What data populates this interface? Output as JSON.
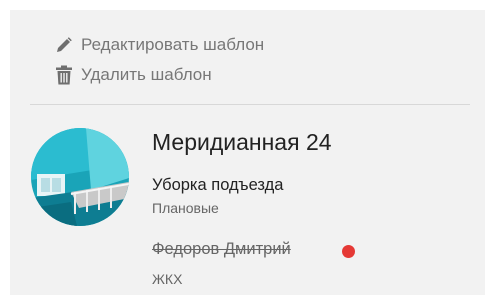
{
  "actions": {
    "edit": {
      "label": "Редактировать шаблон",
      "icon": "pencil-icon"
    },
    "delete": {
      "label": "Удалить шаблон",
      "icon": "trash-icon"
    }
  },
  "card": {
    "title": "Меридианная 24",
    "task": "Уборка подъезда",
    "type": "Плановые",
    "person": "Федоров Дмитрий",
    "person_status_color": "#e53935",
    "org": "ЖКХ",
    "avatar": "stairwell-photo"
  },
  "colors": {
    "panel_background": "#f2f2f2",
    "action_text": "#777777"
  }
}
